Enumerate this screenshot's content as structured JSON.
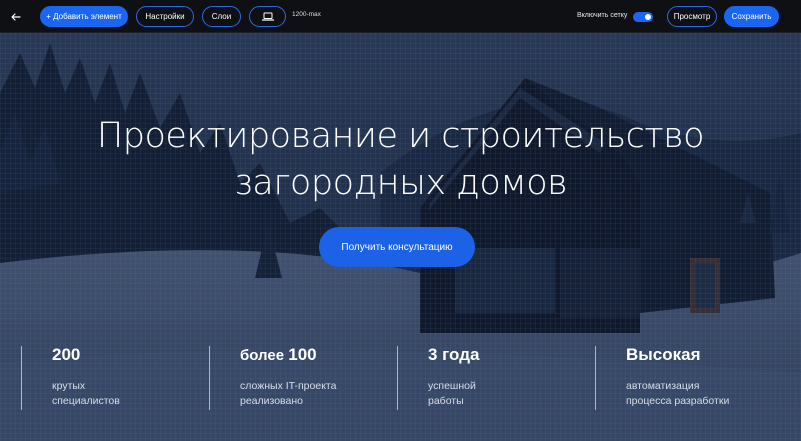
{
  "toolbar": {
    "back_icon": "arrow-left-icon",
    "add_label": "+ Добавить элемент",
    "settings_label": "Настройки",
    "layers_label": "Слои",
    "device_icon": "laptop-icon",
    "width_label": "1200-max",
    "grid_label": "Включить сетку",
    "grid_enabled": true,
    "preview_label": "Просмотр",
    "save_label": "Сохранить"
  },
  "hero": {
    "title_line1": "Проектирование и строительство",
    "title_line2": "загородных домов",
    "cta_label": "Получить консультацию"
  },
  "stats": [
    {
      "prefix": "",
      "value": "200",
      "line1": "крутых",
      "line2": "специалистов"
    },
    {
      "prefix": "более ",
      "value": "100",
      "line1": "сложных IT-проекта",
      "line2": "реализовано"
    },
    {
      "prefix": "",
      "value": "3 года",
      "line1": "успешной",
      "line2": "работы"
    },
    {
      "prefix": "",
      "value": "Высокая",
      "line1": "автоматизация",
      "line2": "процесса разработки"
    }
  ],
  "colors": {
    "accent": "#1a66f1",
    "toolbar_bg": "#0e1014",
    "overlay": "#0c1a33"
  }
}
